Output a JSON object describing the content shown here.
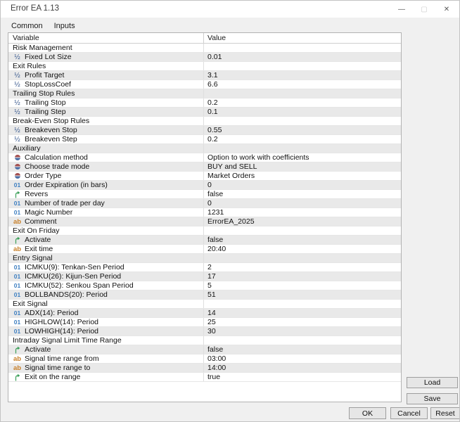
{
  "window": {
    "title": "Error EA 1.13"
  },
  "window_controls": {
    "minimize_glyph": "—",
    "maximize_glyph": "▢",
    "close_glyph": "✕"
  },
  "tabs": [
    {
      "label": "Common",
      "active": false
    },
    {
      "label": "Inputs",
      "active": true
    }
  ],
  "table": {
    "header_variable": "Variable",
    "header_value": "Value",
    "rows": [
      {
        "type": "section",
        "label": "Risk Management",
        "value": ""
      },
      {
        "type": "double",
        "label": "Fixed Lot Size",
        "value": "0.01"
      },
      {
        "type": "section",
        "label": "Exit Rules",
        "value": ""
      },
      {
        "type": "double",
        "label": "Profit Target",
        "value": "3.1"
      },
      {
        "type": "double",
        "label": "StopLossCoef",
        "value": "6.6"
      },
      {
        "type": "section",
        "label": "Trailing Stop Rules",
        "value": ""
      },
      {
        "type": "double",
        "label": "Trailing Stop",
        "value": "0.2"
      },
      {
        "type": "double",
        "label": "Trailing Step",
        "value": "0.1"
      },
      {
        "type": "section",
        "label": "Break-Even Stop Rules",
        "value": ""
      },
      {
        "type": "double",
        "label": "Breakeven Stop",
        "value": "0.55"
      },
      {
        "type": "double",
        "label": "Breakeven Step",
        "value": "0.2"
      },
      {
        "type": "section",
        "label": "Auxiliary",
        "value": ""
      },
      {
        "type": "enum",
        "label": "Calculation method",
        "value": "Option to work with coefficients"
      },
      {
        "type": "enum",
        "label": "Choose trade mode",
        "value": "BUY and SELL"
      },
      {
        "type": "enum",
        "label": "Order Type",
        "value": "Market Orders"
      },
      {
        "type": "int",
        "label": "Order Expiration (in bars)",
        "value": "0"
      },
      {
        "type": "bool",
        "label": "Revers",
        "value": "false"
      },
      {
        "type": "int",
        "label": "Number of trade per day",
        "value": "0"
      },
      {
        "type": "int",
        "label": "Magic Number",
        "value": "1231"
      },
      {
        "type": "string",
        "label": "Comment",
        "value": "ErrorEA_2025"
      },
      {
        "type": "section",
        "label": "Exit On Friday",
        "value": ""
      },
      {
        "type": "bool",
        "label": "Activate",
        "value": "false"
      },
      {
        "type": "string",
        "label": "Exit time",
        "value": "20:40"
      },
      {
        "type": "section",
        "label": "Entry Signal",
        "value": ""
      },
      {
        "type": "int",
        "label": "ICMKU(9): Tenkan-Sen Period",
        "value": "2"
      },
      {
        "type": "int",
        "label": "ICMKU(26): Kijun-Sen Period",
        "value": "17"
      },
      {
        "type": "int",
        "label": "ICMKU(52): Senkou Span Period",
        "value": "5"
      },
      {
        "type": "int",
        "label": "BOLLBANDS(20): Period",
        "value": "51"
      },
      {
        "type": "section",
        "label": "Exit Signal",
        "value": ""
      },
      {
        "type": "int",
        "label": "ADX(14): Period",
        "value": "14"
      },
      {
        "type": "int",
        "label": "HIGHLOW(14): Period",
        "value": "25"
      },
      {
        "type": "int",
        "label": "LOWHIGH(14): Period",
        "value": "30"
      },
      {
        "type": "section",
        "label": "Intraday Signal Limit Time Range",
        "value": ""
      },
      {
        "type": "bool",
        "label": "Activate",
        "value": "false"
      },
      {
        "type": "string",
        "label": "Signal time range from",
        "value": "03:00"
      },
      {
        "type": "string",
        "label": "Signal time range to",
        "value": "14:00"
      },
      {
        "type": "bool",
        "label": "Exit on the range",
        "value": "true"
      }
    ]
  },
  "side_buttons": {
    "load": "Load",
    "save": "Save"
  },
  "bottom_buttons": {
    "ok": "OK",
    "cancel": "Cancel",
    "reset": "Reset"
  },
  "icons": {
    "double": "½",
    "int": "01",
    "string": "ab",
    "bool": "branch-arrow-icon",
    "enum": "sphere-icon"
  },
  "colors": {
    "tab_accent": "#3aa0dc",
    "row_shade": "#e9e9e9",
    "icon_double": "#34558b",
    "icon_int": "#3e7fc1",
    "icon_string": "#c8802a",
    "icon_bool": "#3da05a",
    "enum_top": "#a34f4f",
    "enum_bottom": "#4d6fa5"
  }
}
